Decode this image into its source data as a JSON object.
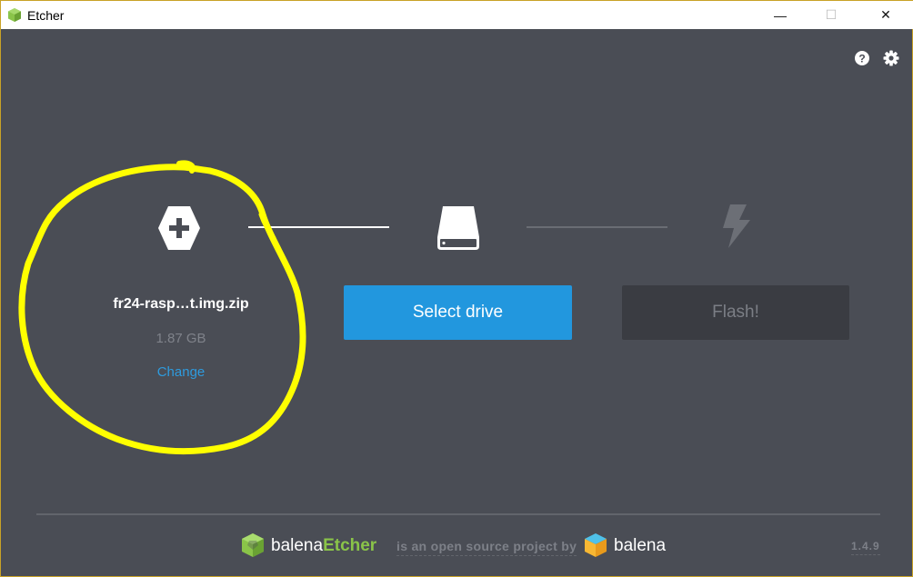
{
  "window": {
    "title": "Etcher",
    "minimize_glyph": "—",
    "maximize_glyph": "☐",
    "close_glyph": "✕"
  },
  "header": {
    "help_icon": "question-circle-icon",
    "settings_icon": "gear-icon"
  },
  "steps": {
    "image": {
      "icon": "plus-hexagon-icon",
      "file_name": "fr24-rasp…t.img.zip",
      "file_size": "1.87 GB",
      "change_label": "Change"
    },
    "drive": {
      "icon": "drive-icon",
      "button_label": "Select drive"
    },
    "flash": {
      "icon": "lightning-bolt-icon",
      "button_label": "Flash!"
    }
  },
  "footer": {
    "brand_prefix": "balena",
    "brand_accent": "Etcher",
    "tagline": "is an open source project by",
    "company": "balena",
    "version": "1.4.9"
  },
  "colors": {
    "background": "#4a4d55",
    "primary_button": "#2297de",
    "disabled_button": "#3a3c42",
    "link": "#2e9bde",
    "brand_green": "#8ac449",
    "annotation": "#ffff00"
  }
}
